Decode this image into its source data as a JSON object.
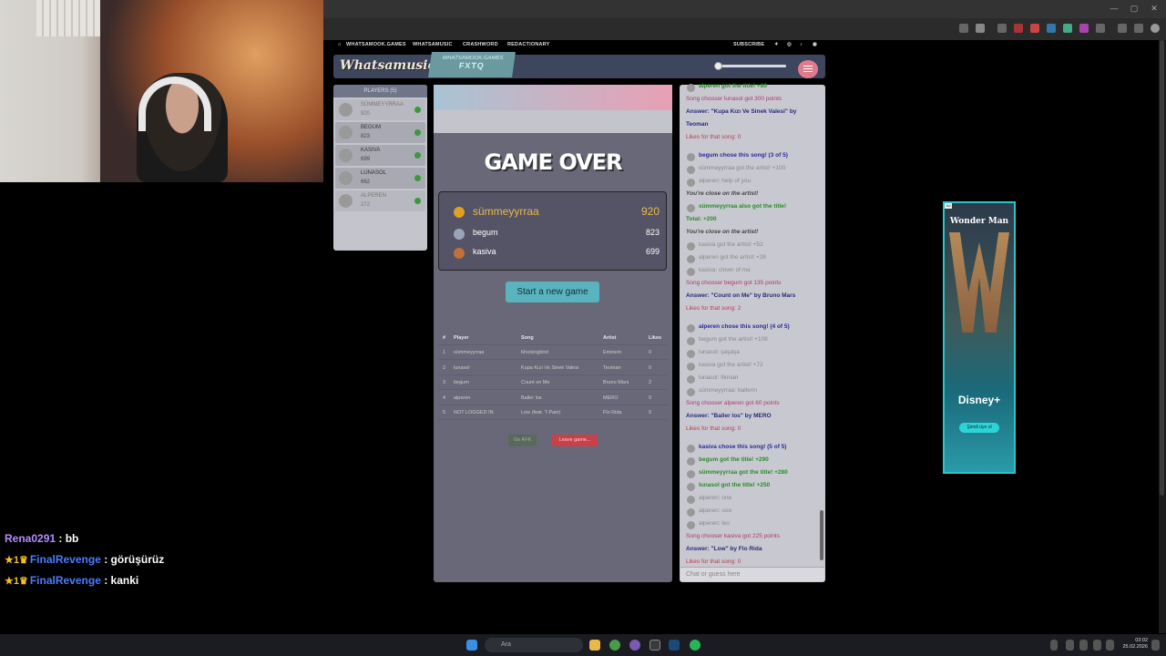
{
  "browser": {
    "window_controls": [
      "—",
      "▢",
      "✕"
    ]
  },
  "site_nav": {
    "home": "WHATSAMOOK.GAMES",
    "whatsamusic": "WHATSAMUSIC",
    "crashword": "CRASHWORD",
    "redactionary": "REDACTIONARY",
    "subscribe": "SUBSCRIBE"
  },
  "header": {
    "logo": "Whatsamusic",
    "badge_top": "WHATSAMOOK.GAMES",
    "badge_bottom": "FXTQ",
    "volume_level": 0.0
  },
  "players_panel": {
    "title": "PLAYERS (5)",
    "players": [
      {
        "name": "SÜMMEYYRRAA",
        "score": "920",
        "dim": true
      },
      {
        "name": "BEGUM",
        "score": "823",
        "dim": false
      },
      {
        "name": "KASIVA",
        "score": "699",
        "dim": false
      },
      {
        "name": "LUNASOL",
        "score": "662",
        "dim": false
      },
      {
        "name": "ALPEREN",
        "score": "272",
        "dim": true
      }
    ]
  },
  "game": {
    "title": "GAME OVER",
    "podium": [
      {
        "name": "sümmeyyrraa",
        "score": "920",
        "medal": "gold"
      },
      {
        "name": "begum",
        "score": "823",
        "medal": "silver"
      },
      {
        "name": "kasiva",
        "score": "699",
        "medal": "bronze"
      }
    ],
    "new_game_label": "Start a new game",
    "table": {
      "headers": [
        "#",
        "Player",
        "Song",
        "Artist",
        "Likes"
      ],
      "rows": [
        [
          "1",
          "sümmeyyrraa",
          "Mockingbird",
          "Eminem",
          "0"
        ],
        [
          "2",
          "lunasol",
          "Kupa Kızı Ve Sinek Valesi",
          "Teoman",
          "0"
        ],
        [
          "3",
          "begum",
          "Count on Me",
          "Bruno Mars",
          "2"
        ],
        [
          "4",
          "alperen",
          "Baller los",
          "MERO",
          "0"
        ],
        [
          "5",
          "NOT LOGGED IN",
          "Low (feat. T-Pain)",
          "Flo Rida",
          "0"
        ]
      ]
    },
    "afk_label": "Go AFK",
    "leave_label": "Leave game..."
  },
  "chat": {
    "messages": [
      {
        "text": "alperen got the title! +80",
        "style": "green",
        "avatar": true
      },
      {
        "text": "Song chooser lunasol got 300 points",
        "style": "pink",
        "avatar": false
      },
      {
        "text": "Answer: \"Kupa Kızı Ve Sinek Valesi\" by",
        "style": "navy",
        "avatar": false
      },
      {
        "text": "Teoman",
        "style": "navy",
        "avatar": false
      },
      {
        "text": "Likes for that song: 0",
        "style": "red",
        "avatar": false
      },
      {
        "text": "begum chose this song! (3 of 5)",
        "style": "blue",
        "avatar": true
      },
      {
        "text": "sümmeyyrraa got the artist! +100",
        "style": "gray",
        "avatar": true
      },
      {
        "text": "alperen: help of you",
        "style": "gray",
        "avatar": true
      },
      {
        "text": "You're close on the artist!",
        "style": "dark",
        "avatar": false
      },
      {
        "text": "sümmeyyrraa also got the title!",
        "style": "green",
        "avatar": true
      },
      {
        "text": "Total: +200",
        "style": "green",
        "avatar": false
      },
      {
        "text": "You're close on the artist!",
        "style": "dark",
        "avatar": false
      },
      {
        "text": "kasiva got the artist! +52",
        "style": "gray",
        "avatar": true
      },
      {
        "text": "alperen got the artist! +28",
        "style": "gray",
        "avatar": true
      },
      {
        "text": "kasiva: clown of me",
        "style": "gray",
        "avatar": true
      },
      {
        "text": "Song chooser begum got 135 points",
        "style": "pink",
        "avatar": false
      },
      {
        "text": "Answer: \"Count on Me\" by Bruno Mars",
        "style": "navy",
        "avatar": false
      },
      {
        "text": "Likes for that song: 2",
        "style": "red",
        "avatar": false
      },
      {
        "text": "alperen chose this song! (4 of 5)",
        "style": "blue",
        "avatar": true
      },
      {
        "text": "begum got the artist! +108",
        "style": "gray",
        "avatar": true
      },
      {
        "text": "lunasol: şaşaşa",
        "style": "gray",
        "avatar": true
      },
      {
        "text": "kasiva got the artist! +72",
        "style": "gray",
        "avatar": true
      },
      {
        "text": "lunasol: fikman",
        "style": "gray",
        "avatar": true
      },
      {
        "text": "sümmeyyrraa: ballerin",
        "style": "gray",
        "avatar": true
      },
      {
        "text": "Song chooser alperen got 60 points",
        "style": "pink",
        "avatar": false
      },
      {
        "text": "Answer: \"Baller los\" by MERO",
        "style": "navy",
        "avatar": false
      },
      {
        "text": "Likes for that song: 0",
        "style": "red",
        "avatar": false
      },
      {
        "text": "kasiva chose this song! (5 of 5)",
        "style": "blue",
        "avatar": true
      },
      {
        "text": "begum got the title! +290",
        "style": "green",
        "avatar": true
      },
      {
        "text": "sümmeyyrraa got the title! +280",
        "style": "green",
        "avatar": true
      },
      {
        "text": "lunasol got the title! +250",
        "style": "green",
        "avatar": true
      },
      {
        "text": "alperen: one",
        "style": "gray",
        "avatar": true
      },
      {
        "text": "alperen: ooo",
        "style": "gray",
        "avatar": true
      },
      {
        "text": "alperen: leo",
        "style": "gray",
        "avatar": true
      },
      {
        "text": "Song chooser kasiva got 225 points",
        "style": "pink",
        "avatar": false
      },
      {
        "text": "Answer: \"Low\" by Flo Rida",
        "style": "navy",
        "avatar": false
      },
      {
        "text": "Likes for that song: 0",
        "style": "red",
        "avatar": false
      }
    ],
    "input_placeholder": "Chat or guess here"
  },
  "ad": {
    "tag": "Ad",
    "title": "Wonder Man",
    "brand": "Disney+",
    "cta": "Şimdi üye ol"
  },
  "stream_chat": [
    {
      "user": "Rena0291",
      "message": "bb",
      "badges": "",
      "color": "#b48cff"
    },
    {
      "user": "FinalRevenge",
      "message": "görüşürüz",
      "badges": "★1♛",
      "color": "#4a7cff"
    },
    {
      "user": "FinalRevenge",
      "message": "kanki",
      "badges": "★1♛",
      "color": "#4a7cff"
    }
  ],
  "taskbar": {
    "search_placeholder": "Ara",
    "time": "03:02",
    "date": "25.02.2026"
  }
}
